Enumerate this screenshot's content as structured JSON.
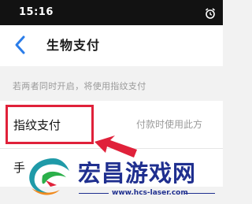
{
  "status_bar": {
    "time": "15:16",
    "icon": "alarm-icon"
  },
  "header": {
    "title": "生物支付",
    "back_icon": "chevron-left-icon"
  },
  "hint": "若两者同时开启，将使用指纹支付",
  "rows": [
    {
      "label": "指纹支付",
      "description": "付款时使用此方"
    },
    {
      "label": "手"
    }
  ],
  "highlight_color": "#e0213a",
  "watermark": {
    "title": "宏昌游戏网",
    "url": "www.hcs-laser.com",
    "color": "#1f2f8f"
  }
}
